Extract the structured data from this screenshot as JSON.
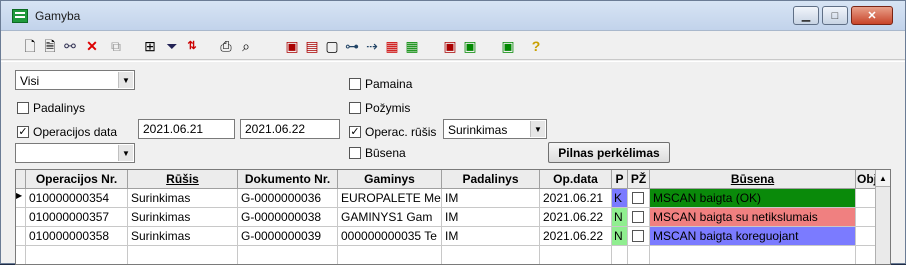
{
  "window": {
    "title": "Gamyba"
  },
  "titlebar_buttons": {
    "minimize": "▁",
    "maximize": "□",
    "close": "✕"
  },
  "toolbar": {
    "icons": [
      "new-document",
      "edit-document",
      "link",
      "delete",
      "copy",
      "tree",
      "filter",
      "sort",
      "print",
      "find",
      "tool-a",
      "tool-b",
      "tool-c",
      "tool-d",
      "tool-e",
      "tool-f",
      "tool-g",
      "tool-h",
      "tool-i",
      "tool-j",
      "help"
    ]
  },
  "filters": {
    "view_select": "Visi",
    "padalinys_label": "Padalinys",
    "padalinys_checked": false,
    "operacijos_data_label": "Operacijos data",
    "operacijos_data_checked": true,
    "date_from": "2021.06.21",
    "date_to": "2021.06.22",
    "extra_select": "",
    "pamaina_label": "Pamaina",
    "pozymis_label": "Požymis",
    "operac_rusis_label": "Operac. rūšis",
    "operac_rusis_checked": true,
    "operac_rusis_value": "Surinkimas",
    "busena_label": "Būsena",
    "full_transfer_button": "Pilnas perkėlimas"
  },
  "table": {
    "columns": [
      "Operacijos Nr.",
      "Rūšis",
      "Dokumento Nr.",
      "Gaminys",
      "Padalinys",
      "Op.data",
      "P",
      "PŽ",
      "Būsena",
      "Obj"
    ],
    "rows": [
      {
        "nr": "010000000354",
        "rusis": "Surinkimas",
        "dok": "G-0000000036",
        "gaminys": "EUROPALETE   Me",
        "padalinys": "IM",
        "data": "2021.06.21",
        "p": "K",
        "busena": "MSCAN baigta (OK)",
        "busena_color": "#0a8a0a",
        "p_color": "#7a7aff"
      },
      {
        "nr": "010000000357",
        "rusis": "Surinkimas",
        "dok": "G-0000000038",
        "gaminys": "GAMINYS1     Gam",
        "padalinys": "IM",
        "data": "2021.06.22",
        "p": "N",
        "busena": "MSCAN baigta su netikslumais",
        "busena_color": "#f08080",
        "p_color": "#90ee90"
      },
      {
        "nr": "010000000358",
        "rusis": "Surinkimas",
        "dok": "G-0000000039",
        "gaminys": "000000000035 Te",
        "padalinys": "IM",
        "data": "2021.06.22",
        "p": "N",
        "busena": "MSCAN baigta koreguojant",
        "busena_color": "#7b7bff",
        "p_color": "#90ee90"
      }
    ]
  }
}
